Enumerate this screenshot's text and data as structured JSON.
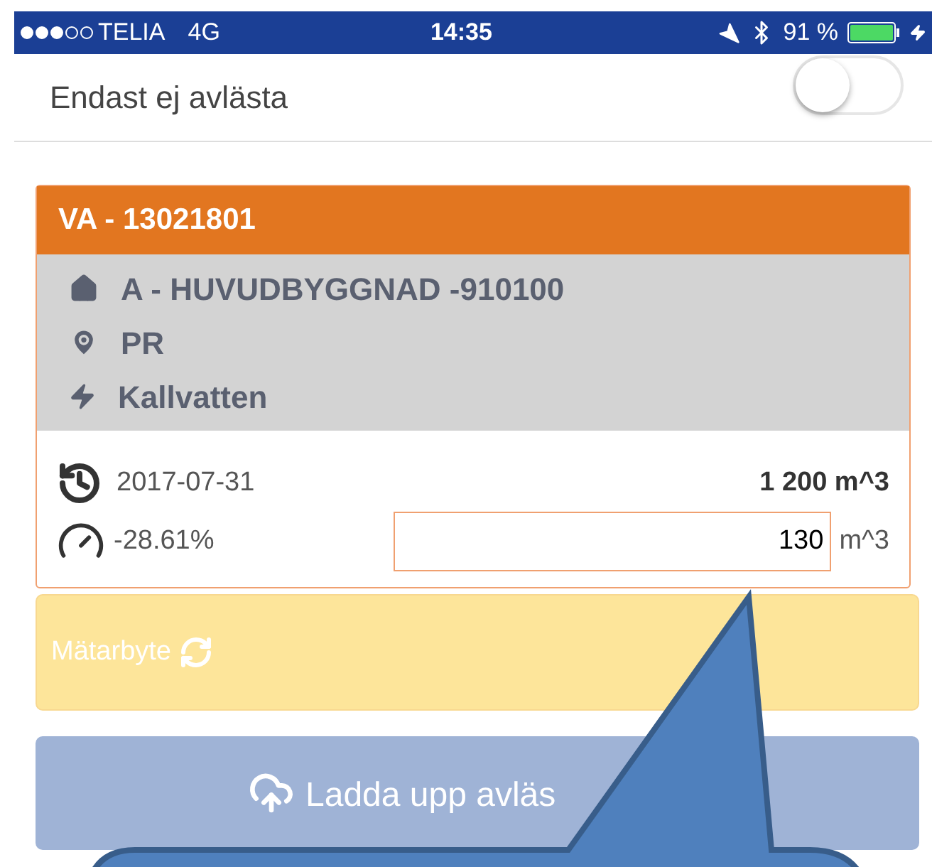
{
  "status_bar": {
    "carrier": "TELIA",
    "network": "4G",
    "time": "14:35",
    "battery": "91 %"
  },
  "filter": {
    "label": "Endast ej avlästa",
    "on": false
  },
  "meter_card": {
    "title": "VA - 13021801",
    "building": "A - HUVUDBYGGNAD -910100",
    "location": "PR",
    "medium": "Kallvatten",
    "last_date": "2017-07-31",
    "last_value": "1 200 m^3",
    "deviation": "-28.61%",
    "reading": "130",
    "unit": "m^3"
  },
  "swap_button": {
    "label": "Mätarbyte"
  },
  "upload_button": {
    "label": "Ladda upp avläs"
  }
}
